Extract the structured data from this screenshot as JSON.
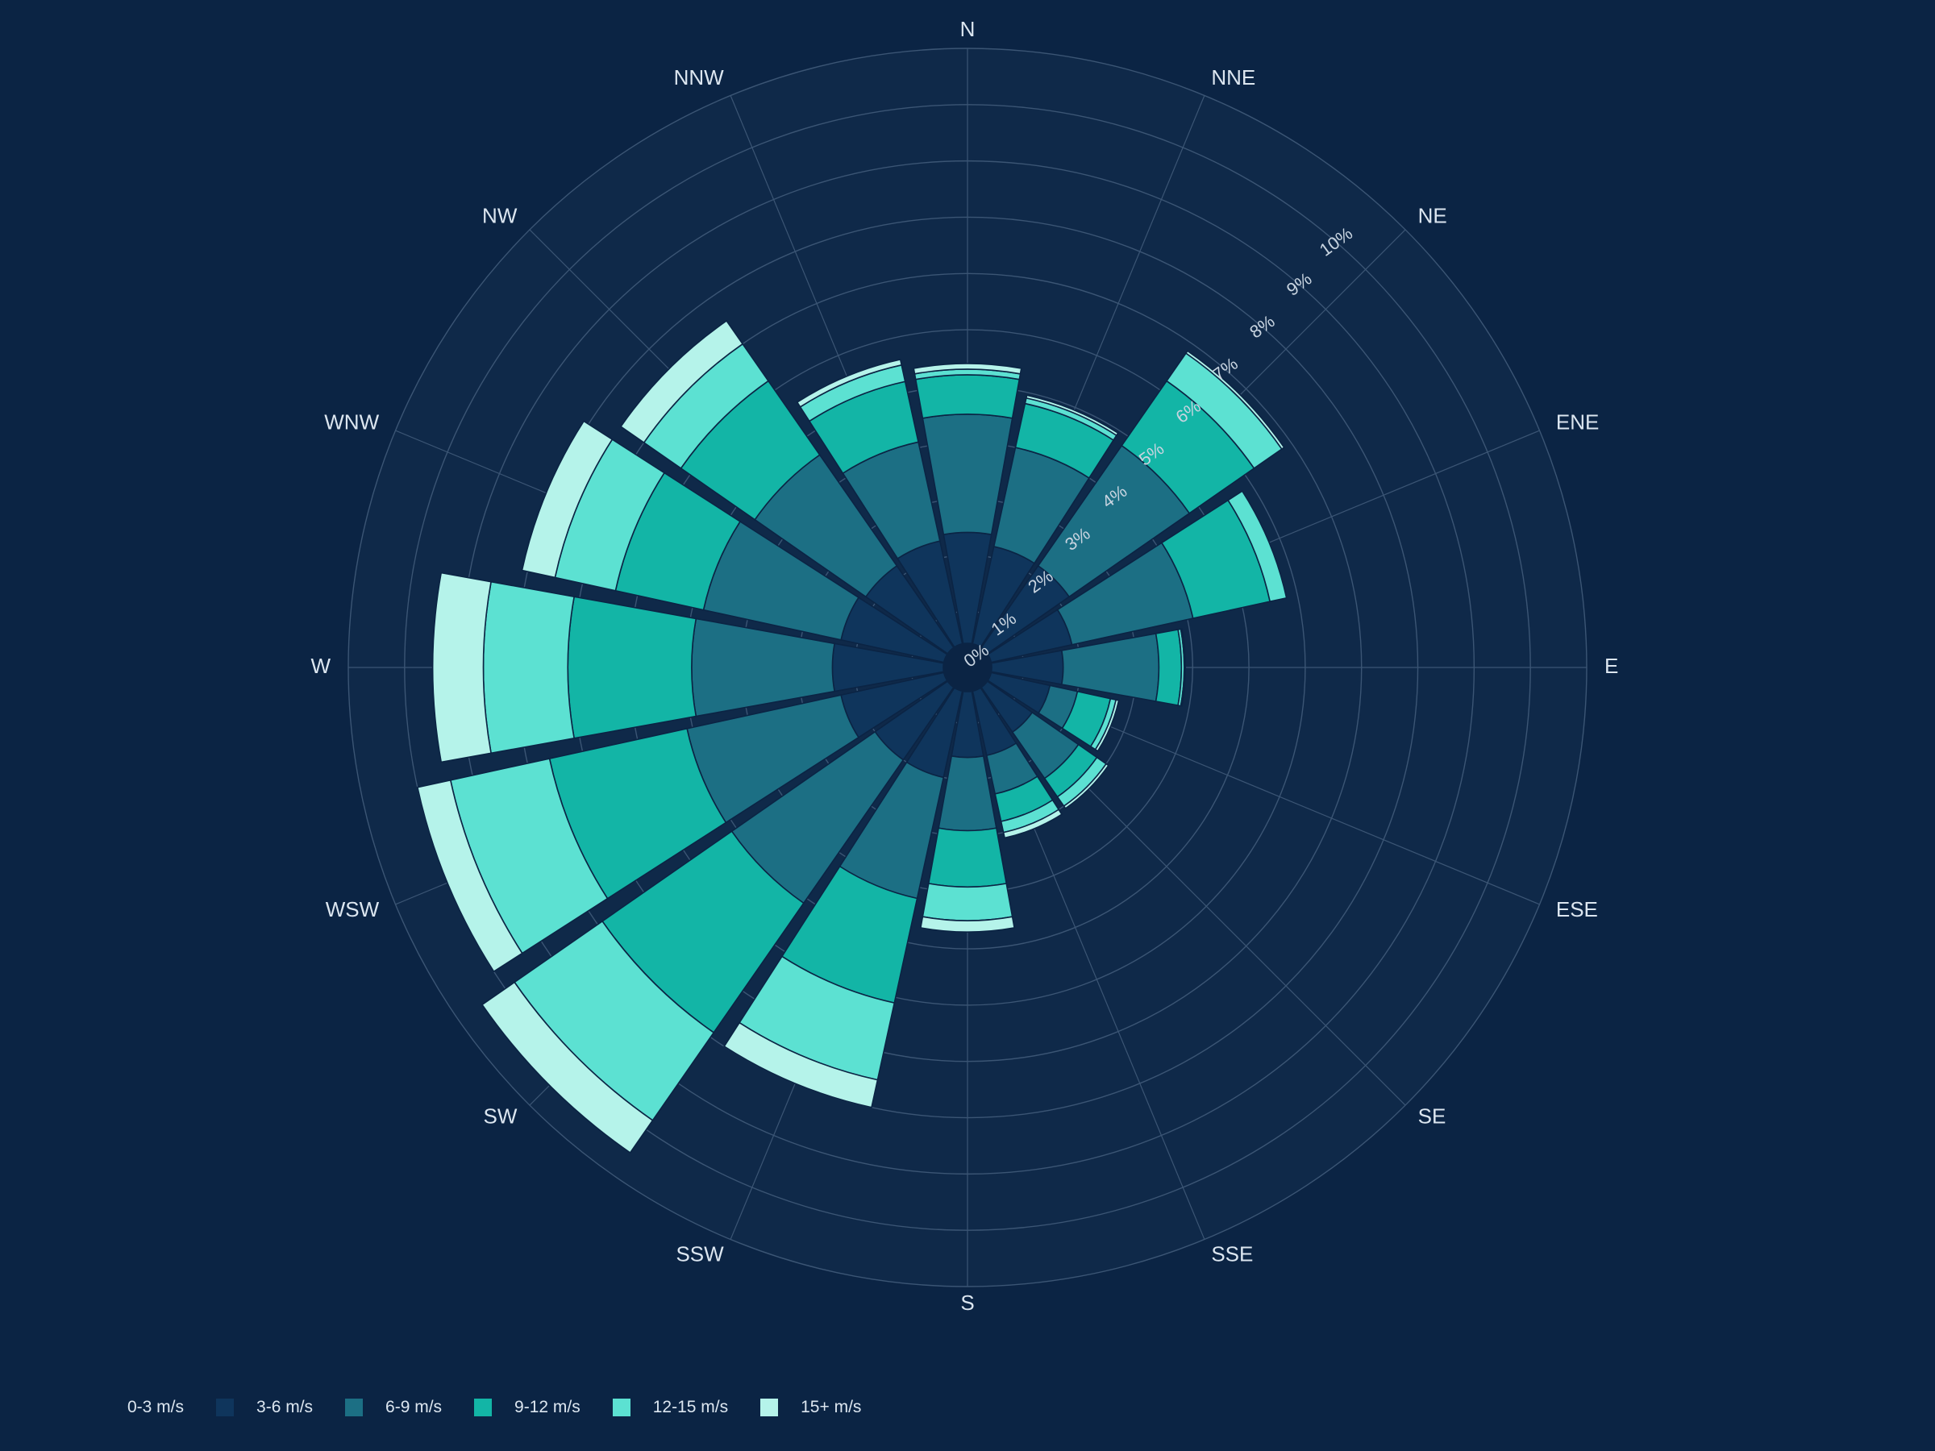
{
  "chart_data": {
    "type": "windrose",
    "directions": [
      "N",
      "NNE",
      "NE",
      "ENE",
      "E",
      "ESE",
      "SE",
      "SSE",
      "S",
      "SSW",
      "SW",
      "WSW",
      "W",
      "WNW",
      "NW",
      "NNW"
    ],
    "radial_ticks": [
      "0%",
      "1%",
      "2%",
      "3%",
      "4%",
      "5%",
      "6%",
      "7%",
      "8%",
      "9%",
      "10%"
    ],
    "rmax": 11,
    "series": [
      {
        "name": "0-3 m/s",
        "color": "#0f355c",
        "values": [
          2.4,
          2.2,
          2.2,
          1.9,
          1.7,
          1.5,
          1.4,
          1.6,
          1.6,
          2.0,
          2.0,
          2.3,
          2.4,
          2.3,
          2.2,
          2.3
        ]
      },
      {
        "name": "3-6 m/s",
        "color": "#1c6f84",
        "values": [
          2.1,
          1.8,
          2.6,
          2.2,
          1.7,
          0.5,
          1.0,
          0.7,
          1.3,
          2.2,
          3.1,
          2.8,
          2.5,
          2.5,
          2.4,
          1.8
        ]
      },
      {
        "name": "6-9 m/s",
        "color": "#13b5a6",
        "values": [
          0.7,
          0.8,
          1.4,
          1.4,
          0.4,
          0.6,
          0.4,
          0.5,
          1.0,
          1.9,
          2.8,
          2.5,
          2.2,
          1.6,
          1.6,
          1.1
        ]
      },
      {
        "name": "9-12 m/s",
        "color": "#5ce1d2",
        "values": [
          0.1,
          0.1,
          0.6,
          0.3,
          0.05,
          0.1,
          0.2,
          0.2,
          0.6,
          1.4,
          1.9,
          1.8,
          1.5,
          1.1,
          0.8,
          0.3
        ]
      },
      {
        "name": "12-15 m/s",
        "color": "#b5f3ea",
        "values": [
          0.1,
          0.05,
          0.05,
          0.0,
          0.02,
          0.05,
          0.05,
          0.1,
          0.2,
          0.5,
          0.7,
          0.6,
          0.9,
          0.6,
          0.5,
          0.1
        ]
      }
    ],
    "legend": [
      "0-3 m/s",
      "3-6 m/s",
      "6-9 m/s",
      "9-12 m/s",
      "12-15 m/s",
      "15+ m/s"
    ],
    "legend_colors": [
      "#0f355c",
      "#1c6f84",
      "#13b5a6",
      "#5ce1d2",
      "#b5f3ea"
    ],
    "legend_placement": "bottom-left"
  }
}
